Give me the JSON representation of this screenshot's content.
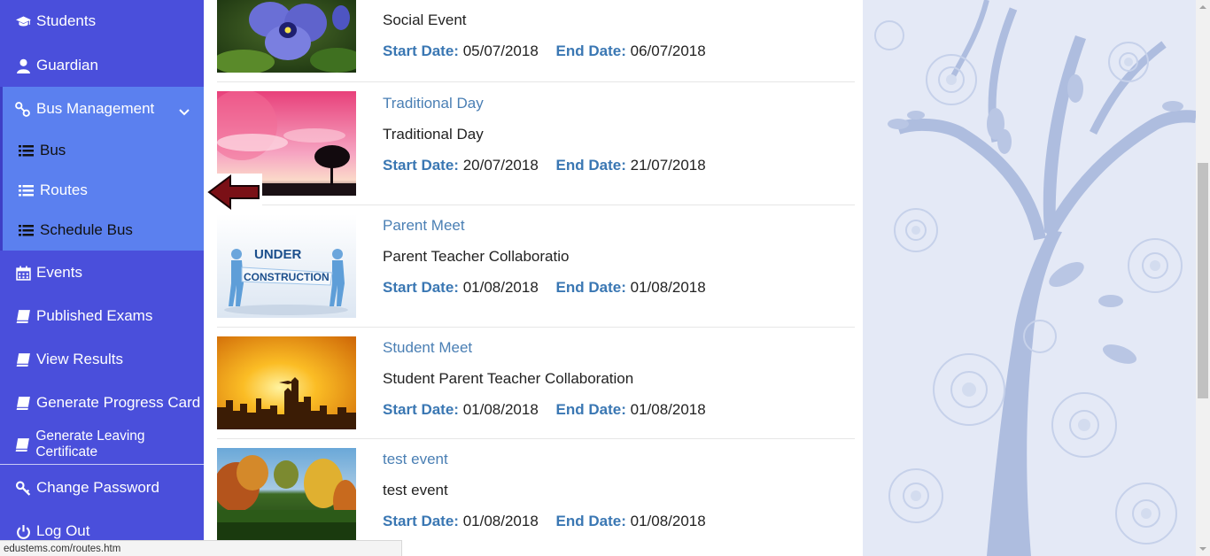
{
  "sidebar": {
    "items_top": [
      {
        "label": "Students",
        "icon": "graduation-cap-icon"
      },
      {
        "label": "Guardian",
        "icon": "user-icon"
      }
    ],
    "bus_management": {
      "label": "Bus Management",
      "icon": "bus-route-icon",
      "sub_items": [
        {
          "label": "Bus",
          "icon": "list-icon"
        },
        {
          "label": "Routes",
          "icon": "list-icon"
        },
        {
          "label": "Schedule Bus",
          "icon": "list-icon"
        }
      ]
    },
    "items_bottom": [
      {
        "label": "Events",
        "icon": "calendar-icon"
      },
      {
        "label": "Published Exams",
        "icon": "book-icon"
      },
      {
        "label": "View Results",
        "icon": "book-icon"
      },
      {
        "label": "Generate Progress Card",
        "icon": "book-icon"
      },
      {
        "label": "Generate Leaving Certificate",
        "icon": "book-icon"
      }
    ],
    "items_account": [
      {
        "label": "Change Password",
        "icon": "key-icon"
      },
      {
        "label": "Log Out",
        "icon": "power-icon"
      }
    ]
  },
  "labels": {
    "start_date": "Start Date:",
    "end_date": "End Date:"
  },
  "events": [
    {
      "title": "",
      "description": "Social Event",
      "start": "05/07/2018",
      "end": "06/07/2018",
      "image": "purple-flower"
    },
    {
      "title": "Traditional Day",
      "description": "Traditional Day",
      "start": "20/07/2018",
      "end": "21/07/2018",
      "image": "pink-sunset-tree"
    },
    {
      "title": "Parent Meet",
      "description": "Parent Teacher Collaboratio",
      "start": "01/08/2018",
      "end": "01/08/2018",
      "image": "under-construction"
    },
    {
      "title": "Student Meet",
      "description": "Student Parent Teacher Collaboration",
      "start": "01/08/2018",
      "end": "01/08/2018",
      "image": "orange-city-skyline"
    },
    {
      "title": "test event",
      "description": "test event",
      "start": "01/08/2018",
      "end": "01/08/2018",
      "image": "autumn-landscape"
    }
  ],
  "status_bar": {
    "url": "edustems.com/routes.htm"
  },
  "colors": {
    "sidebar": "#4a4fdb",
    "submenu": "#5b80ef",
    "title_link": "#4a7fb4",
    "date_label": "#3a77b3",
    "arrow": "#7a1016"
  }
}
